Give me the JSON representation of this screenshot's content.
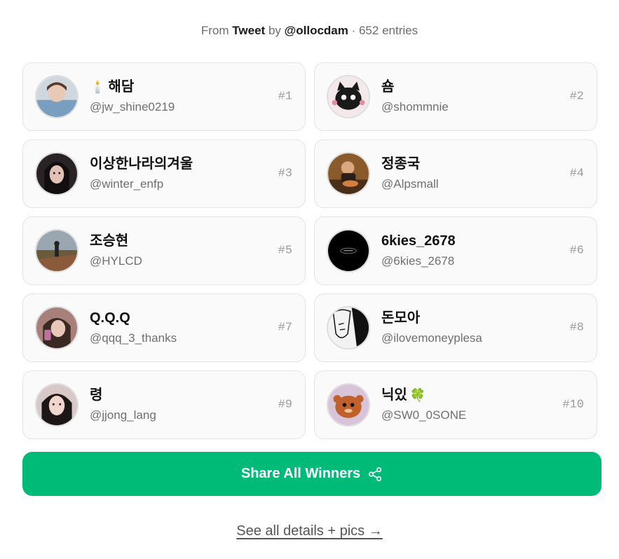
{
  "header": {
    "prefix": "From",
    "source": "Tweet",
    "by": "by",
    "author": "@ollocdam",
    "entries": "· 652 entries"
  },
  "winners": [
    {
      "name": "해담",
      "name_emoji": "🕯️",
      "handle": "@jw_shine0219",
      "rank": "#1",
      "avatar_color": "#7a9ec0",
      "avatar_icon": "person-photo"
    },
    {
      "name": "숌",
      "handle": "@shommnie",
      "rank": "#2",
      "avatar_color": "#1a1a1a",
      "avatar_icon": "cat-drawing"
    },
    {
      "name": "이상한나라의겨울",
      "handle": "@winter_enfp",
      "rank": "#3",
      "avatar_color": "#2a2326",
      "avatar_icon": "person-photo"
    },
    {
      "name": "정종국",
      "handle": "@Alpsmall",
      "rank": "#4",
      "avatar_color": "#8a5a2a",
      "avatar_icon": "person-photo"
    },
    {
      "name": "조승현",
      "handle": "@HYLCD",
      "rank": "#5",
      "avatar_color": "#6b5a3a",
      "avatar_icon": "landscape-photo"
    },
    {
      "name": "6kies_2678",
      "handle": "@6kies_2678",
      "rank": "#6",
      "avatar_color": "#000000",
      "avatar_icon": "logo-black"
    },
    {
      "name": "Q.Q.Q",
      "handle": "@qqq_3_thanks",
      "rank": "#7",
      "avatar_color": "#a8807a",
      "avatar_icon": "person-photo"
    },
    {
      "name": "돈모아",
      "handle": "@ilovemoneyplesa",
      "rank": "#8",
      "avatar_color": "#f2f2f2",
      "avatar_icon": "manga-drawing"
    },
    {
      "name": "령",
      "handle": "@jjong_lang",
      "rank": "#9",
      "avatar_color": "#d8c8c8",
      "avatar_icon": "person-photo"
    },
    {
      "name": "닉있",
      "name_emoji": "🍀",
      "handle": "@SW0_0SONE",
      "rank": "#10",
      "avatar_color": "#c0602a",
      "avatar_icon": "plush-toy"
    }
  ],
  "share_button": {
    "label": "Share All Winners",
    "color": "#00bb77",
    "icon": "share-icon"
  },
  "details_link": {
    "label": "See all details + pics →"
  }
}
